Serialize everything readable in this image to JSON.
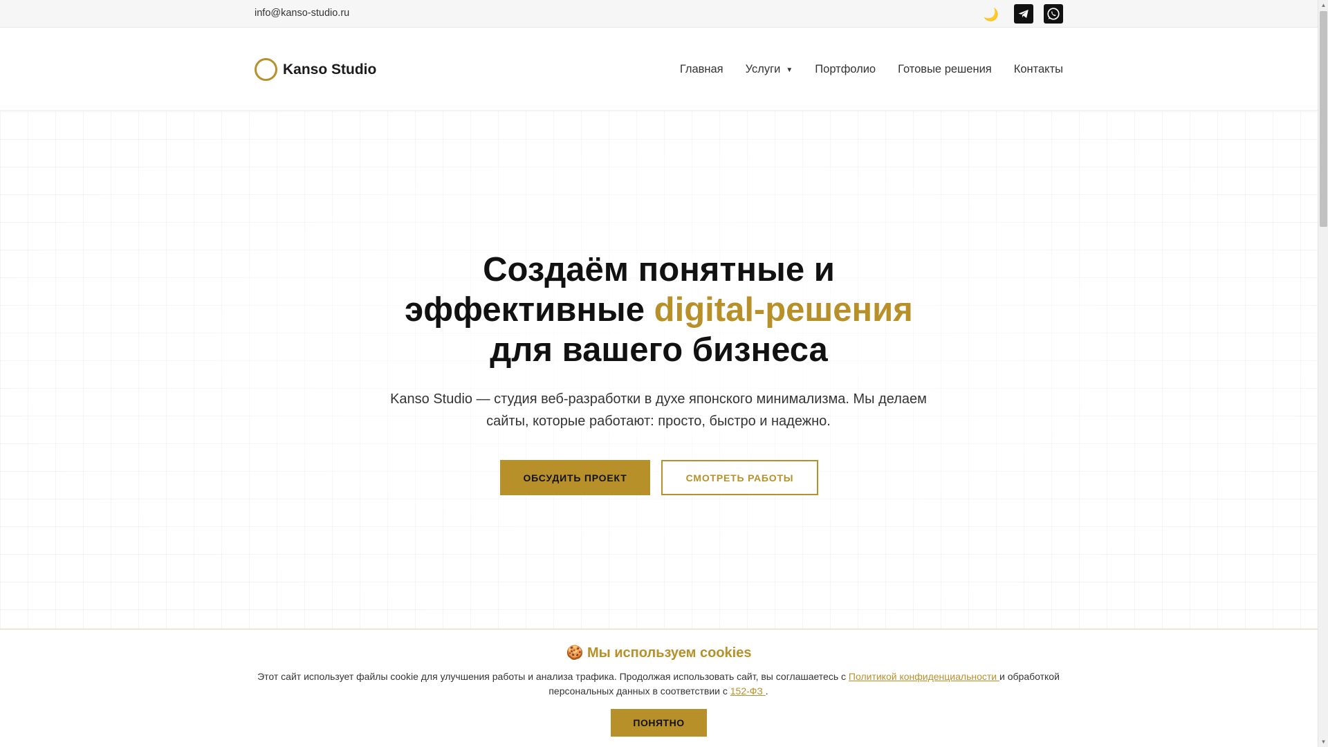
{
  "topbar": {
    "email": "info@kanso-studio.ru",
    "theme_icon": "🌙"
  },
  "header": {
    "logo_text": "Kanso Studio",
    "nav": {
      "home": "Главная",
      "services": "Услуги",
      "services_caret": "▼",
      "portfolio": "Портфолио",
      "solutions": "Готовые решения",
      "contacts": "Контакты"
    }
  },
  "hero": {
    "title_line1": "Создаём понятные и",
    "title_line2_plain": "эффективные ",
    "title_line2_accent": "digital-решения",
    "title_line3": "для вашего бизнеса",
    "subtitle": "Kanso Studio — студия веб-разработки в духе японского минимализма. Мы делаем сайты, которые работают: просто, быстро и надежно.",
    "btn_primary": "ОБСУДИТЬ ПРОЕКТ",
    "btn_secondary": "СМОТРЕТЬ РАБОТЫ"
  },
  "cookie": {
    "icon": "🍪",
    "title": "Мы используем cookies",
    "text_part1": "Этот сайт использует файлы cookie для улучшения работы и анализа трафика. Продолжая использовать сайт, вы соглашаетесь с ",
    "privacy_link": "Политикой конфиденциальности ",
    "text_part2": " и обработкой персональных данных в соответствии с ",
    "law_link": "152-ФЗ ",
    "text_part3": ".",
    "button": "ПОНЯТНО"
  },
  "colors": {
    "accent": "#b8902a",
    "text": "#1a1a1a",
    "topbar_bg": "#f6f6f6"
  }
}
